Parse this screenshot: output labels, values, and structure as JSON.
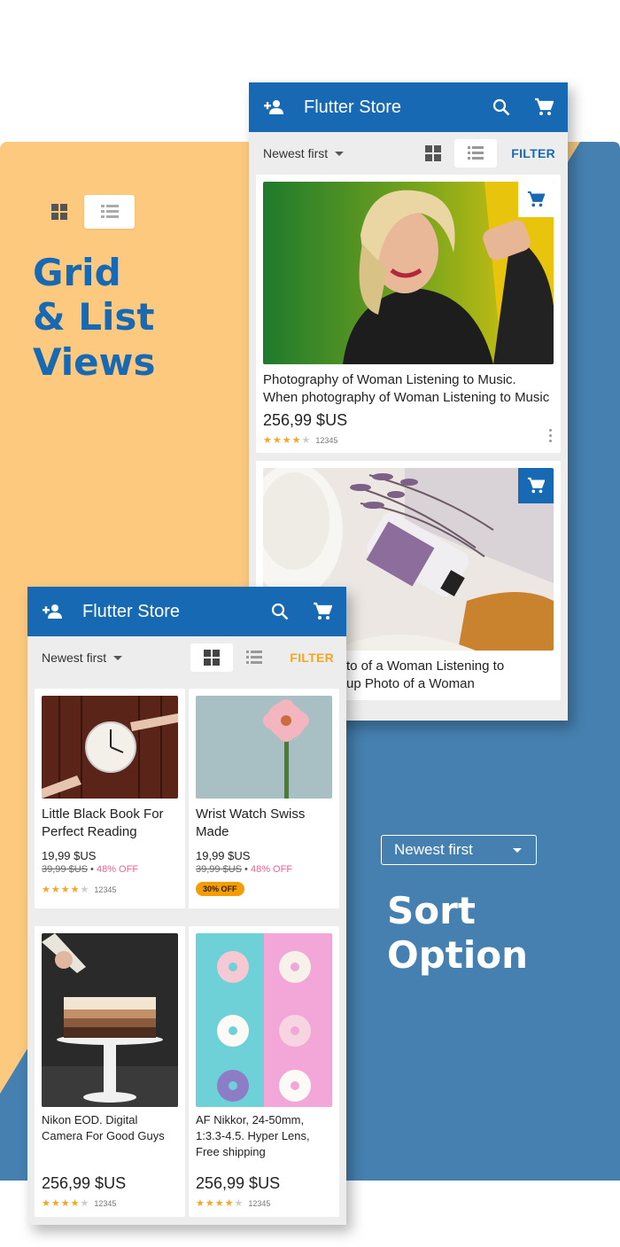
{
  "colors": {
    "primary": "#1769b3",
    "accent_orange": "#f5a623",
    "bg_orange": "#fcc97e",
    "bg_blue": "#4580b0",
    "discount_pink": "#f06292"
  },
  "promo": {
    "grid_list_line1": "Grid",
    "grid_list_line2": "& List",
    "grid_list_line3": "Views",
    "sort_line1": "Sort",
    "sort_line2": "Option",
    "sort_dropdown_value": "Newest first"
  },
  "phone_list": {
    "appbar": {
      "title": "Flutter Store",
      "icons": [
        "person-add-icon",
        "search-icon",
        "cart-icon"
      ]
    },
    "sortbar": {
      "sort_value": "Newest first",
      "filter_label": "FILTER",
      "active_view": "list"
    },
    "products": [
      {
        "title": "Photography of Woman Listening to Music. When photography of Woman Listening to Music",
        "price": "256,99 $US",
        "rating": 4,
        "review_count": "12345"
      },
      {
        "title_partial_line1": "to of a Woman Listening to",
        "title_partial_line2": "up Photo of a Woman"
      }
    ]
  },
  "phone_grid": {
    "appbar": {
      "title": "Flutter Store",
      "icons": [
        "person-add-icon",
        "search-icon",
        "cart-icon"
      ]
    },
    "sortbar": {
      "sort_value": "Newest first",
      "filter_label": "FILTER",
      "active_view": "grid"
    },
    "products": [
      {
        "title": "Little Black Book For Perfect Reading",
        "price": "19,99 $US",
        "old_price": "39,99 $US",
        "separator": "•",
        "discount": "48% OFF",
        "rating": 4,
        "review_count": "12345"
      },
      {
        "title": "Wrist Watch Swiss Made",
        "price": "19,99 $US",
        "old_price": "39,99 $US",
        "separator": "•",
        "discount": "48% OFF",
        "badge": "30% OFF"
      },
      {
        "title": "Nikon EOD. Digital Camera For Good Guys",
        "price": "256,99 $US",
        "rating": 4,
        "review_count": "12345"
      },
      {
        "title": "AF Nikkor, 24-50mm, 1:3.3-4.5. Hyper Lens, Free shipping",
        "price": "256,99 $US",
        "rating": 4,
        "review_count": "12345"
      }
    ]
  }
}
